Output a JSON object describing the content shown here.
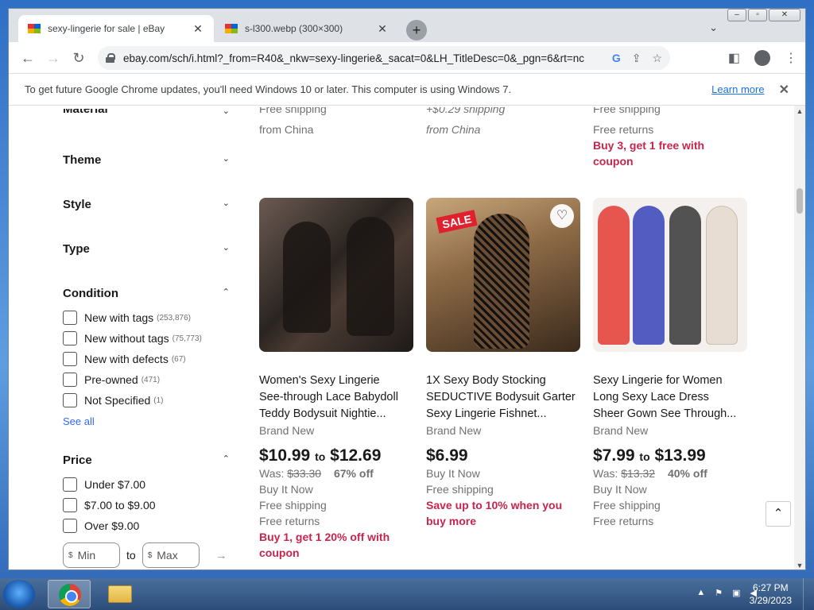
{
  "browser": {
    "tabs": [
      {
        "title": "sexy-lingerie for sale | eBay",
        "close": "✕"
      },
      {
        "title": "s-l300.webp (300×300)",
        "close": "✕"
      }
    ],
    "new_tab": "+",
    "url": "ebay.com/sch/i.html?_from=R40&_nkw=sexy-lingerie&_sacat=0&LH_TitleDesc=0&_pgn=6&rt=nc",
    "infobar": {
      "message": "To get future Google Chrome updates, you'll need Windows 10 or later. This computer is using Windows 7.",
      "learn_more": "Learn more"
    }
  },
  "sidebar": {
    "facets": [
      {
        "label": "Material"
      },
      {
        "label": "Theme"
      },
      {
        "label": "Style"
      },
      {
        "label": "Type"
      }
    ],
    "condition": {
      "label": "Condition",
      "options": [
        {
          "label": "New with tags",
          "count": "(253,876)"
        },
        {
          "label": "New without tags",
          "count": "(75,773)"
        },
        {
          "label": "New with defects",
          "count": "(67)"
        },
        {
          "label": "Pre-owned",
          "count": "(471)"
        },
        {
          "label": "Not Specified",
          "count": "(1)"
        }
      ],
      "see_all": "See all"
    },
    "price": {
      "label": "Price",
      "options": [
        {
          "label": "Under $7.00"
        },
        {
          "label": "$7.00 to $9.00"
        },
        {
          "label": "Over $9.00"
        }
      ],
      "currency": "$",
      "min_placeholder": "Min",
      "to": "to",
      "max_placeholder": "Max"
    }
  },
  "top_fragments": {
    "col1": [
      "Free shipping",
      "from China"
    ],
    "col2": [
      "+$0.29 shipping",
      "from China"
    ],
    "col3": [
      "Free shipping",
      "Free returns",
      "Buy 3, get 1 free with",
      "coupon"
    ]
  },
  "products": [
    {
      "title_lines": [
        "Women's Sexy Lingerie",
        "See-through Lace Babydoll",
        "Teddy Bodysuit Nightie..."
      ],
      "condition": "Brand New",
      "price_low": "$10.99",
      "price_to": "to",
      "price_high": "$12.69",
      "was_label": "Was:",
      "was": "$33.30",
      "discount": "67% off",
      "lines": [
        "Buy It Now",
        "Free shipping",
        "Free returns"
      ],
      "promo_lines": [
        "Buy 1, get 1 20% off with",
        "coupon"
      ]
    },
    {
      "title_lines": [
        "1X Sexy Body Stocking",
        "SEDUCTIVE Bodysuit Garter",
        "Sexy Lingerie Fishnet..."
      ],
      "condition": "Brand New",
      "price": "$6.99",
      "lines": [
        "Buy It Now",
        "Free shipping"
      ],
      "promo_lines": [
        "Save up to 10% when you",
        "buy more"
      ],
      "sale_tag": "SALE"
    },
    {
      "title_lines": [
        "Sexy Lingerie for Women",
        "Long Sexy Lace Dress",
        "Sheer Gown See Through..."
      ],
      "condition": "Brand New",
      "price_low": "$7.99",
      "price_to": "to",
      "price_high": "$13.99",
      "was_label": "Was:",
      "was": "$13.32",
      "discount": "40% off",
      "lines": [
        "Buy It Now",
        "Free shipping",
        "Free returns"
      ]
    }
  ],
  "taskbar": {
    "time": "6:27 PM",
    "date": "3/29/2023"
  },
  "colors": {
    "promo": "#c7254e",
    "link": "#3665f3",
    "chrome_tabstrip": "#dee1e6"
  }
}
